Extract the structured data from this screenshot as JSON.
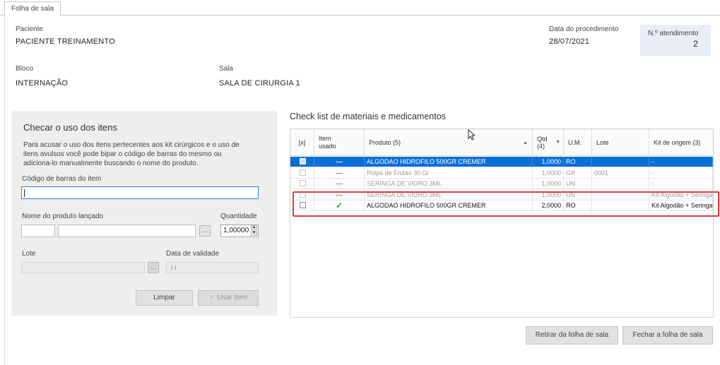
{
  "tab": {
    "label": "Folha de sala"
  },
  "header": {
    "paciente_label": "Paciente",
    "paciente_value": "PACIENTE TREINAMENTO",
    "data_label": "Data do procedimento",
    "data_value": "28/07/2021",
    "atendimento_label": "N.º atendimento",
    "atendimento_value": "2",
    "bloco_label": "Bloco",
    "bloco_value": "INTERNAÇÃO",
    "sala_label": "Sala",
    "sala_value": "SALA DE CIRURGIA 1"
  },
  "panel": {
    "title": "Checar o uso dos itens",
    "description": "Para acusar o uso dos itens pertecentes aos kit cirúrgicos e o uso de itens avulsos você pode bipar o código de barras do mesmo ou adiciona-lo manualmente buscando o nome do produto.",
    "barcode_label": "Código de barras do item",
    "barcode_value": "",
    "product_label": "Nome do produto lançado",
    "quantity_label": "Quantidade",
    "quantity_value": "1,00000",
    "lote_label": "Lote",
    "validade_label": "Data de validade",
    "validade_value": "/ /",
    "ellipsis": "...",
    "limpar_label": "Limpar",
    "usar_label": "Usar item"
  },
  "grid": {
    "title": "Check list de materiais e medicamentos",
    "columns": {
      "check": "[x]",
      "usado": "Item usado",
      "produto": "Produto (5)",
      "qtd": "Qtd (4)",
      "um": "U.M.",
      "lote": "Lote",
      "kit": "Kit de origem (3)"
    },
    "rows": [
      {
        "produto": "ALGODAO HIDROFILO 500GR CREMER",
        "qtd": "1,0000",
        "um": "RO",
        "lote": "",
        "kit": "-",
        "state": "selected",
        "used": "dash"
      },
      {
        "produto": "Polpa de Frutas 30 Gr",
        "qtd": "1,0000",
        "um": "GR",
        "lote": "0001",
        "kit": "-",
        "state": "dim",
        "used": "dash"
      },
      {
        "produto": "SERINGA DE VIDRO 3ML",
        "qtd": "1,0000",
        "um": "UN",
        "lote": "",
        "kit": "-",
        "state": "dim",
        "used": "dash"
      },
      {
        "produto": "SERINGA DE VIDRO 3ML",
        "qtd": "1,0000",
        "um": "UN",
        "lote": "",
        "kit": "Kit Algodão + Seringa",
        "state": "dim",
        "used": "dash"
      },
      {
        "produto": "ALGODAO HIDROFILO 500GR CREMER",
        "qtd": "2,0000",
        "um": "RO",
        "lote": "",
        "kit": "Kit Algodão + Seringa",
        "state": "normal",
        "used": "check"
      }
    ]
  },
  "footer": {
    "retirar_label": "Retirar da folha de sala",
    "fechar_label": "Fechar a folha de sala"
  },
  "colors": {
    "selection": "#0a6fd6",
    "highlight": "#e23b3b",
    "check": "#2e9e3e"
  }
}
